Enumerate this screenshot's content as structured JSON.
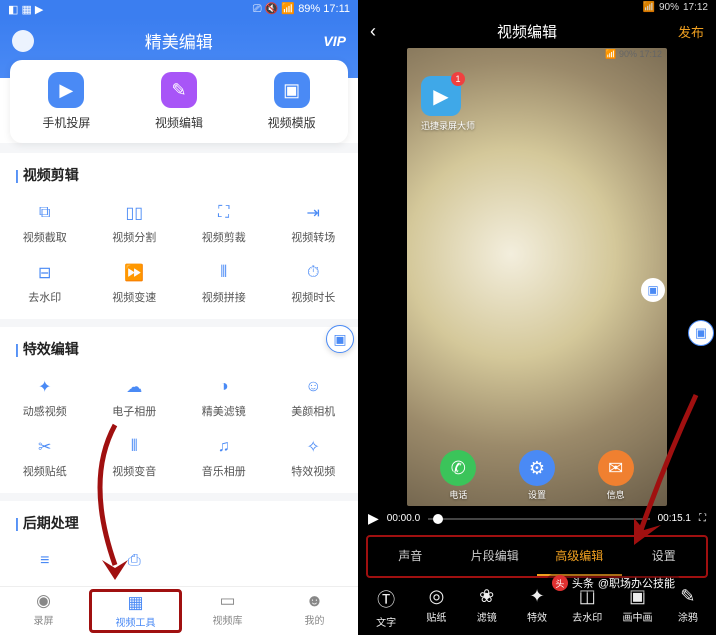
{
  "left": {
    "status": {
      "battery": "89%",
      "time": "17:11"
    },
    "header": {
      "title": "精美编辑",
      "vip": "VIP"
    },
    "top_cards": [
      {
        "label": "手机投屏",
        "icon": "phone-cast"
      },
      {
        "label": "视频编辑",
        "icon": "video-edit"
      },
      {
        "label": "视频模版",
        "icon": "video-template"
      }
    ],
    "sections": {
      "clip": {
        "title": "视频剪辑",
        "items": [
          {
            "label": "视频截取"
          },
          {
            "label": "视频分割"
          },
          {
            "label": "视频剪裁"
          },
          {
            "label": "视频转场"
          },
          {
            "label": "去水印"
          },
          {
            "label": "视频变速"
          },
          {
            "label": "视频拼接"
          },
          {
            "label": "视频时长"
          }
        ]
      },
      "effects": {
        "title": "特效编辑",
        "items": [
          {
            "label": "动感视频"
          },
          {
            "label": "电子相册"
          },
          {
            "label": "精美滤镜"
          },
          {
            "label": "美颜相机"
          },
          {
            "label": "视频贴纸"
          },
          {
            "label": "视频变音"
          },
          {
            "label": "音乐相册"
          },
          {
            "label": "特效视频"
          }
        ]
      },
      "post": {
        "title": "后期处理"
      }
    },
    "bottom_nav": [
      {
        "label": "录屏"
      },
      {
        "label": "视频工具"
      },
      {
        "label": "视频库"
      },
      {
        "label": "我的"
      }
    ]
  },
  "right": {
    "status": {
      "battery": "90%",
      "time": "17:12"
    },
    "header": {
      "title": "视频编辑",
      "publish": "发布"
    },
    "phone": {
      "app": {
        "label": "迅捷录屏大师",
        "badge": "1"
      },
      "dock": [
        {
          "label": "电话"
        },
        {
          "label": "设置"
        },
        {
          "label": "信息"
        }
      ]
    },
    "player": {
      "current": "00:00.0",
      "total": "00:15.1"
    },
    "tabs": [
      {
        "label": "声音"
      },
      {
        "label": "片段编辑"
      },
      {
        "label": "高级编辑"
      },
      {
        "label": "设置"
      }
    ],
    "tools": [
      {
        "label": "文字"
      },
      {
        "label": "贴纸"
      },
      {
        "label": "滤镜"
      },
      {
        "label": "特效"
      },
      {
        "label": "去水印"
      },
      {
        "label": "画中画"
      },
      {
        "label": "涂鸦"
      }
    ],
    "watermark": {
      "prefix": "头条",
      "author": "@职场办公技能"
    }
  }
}
